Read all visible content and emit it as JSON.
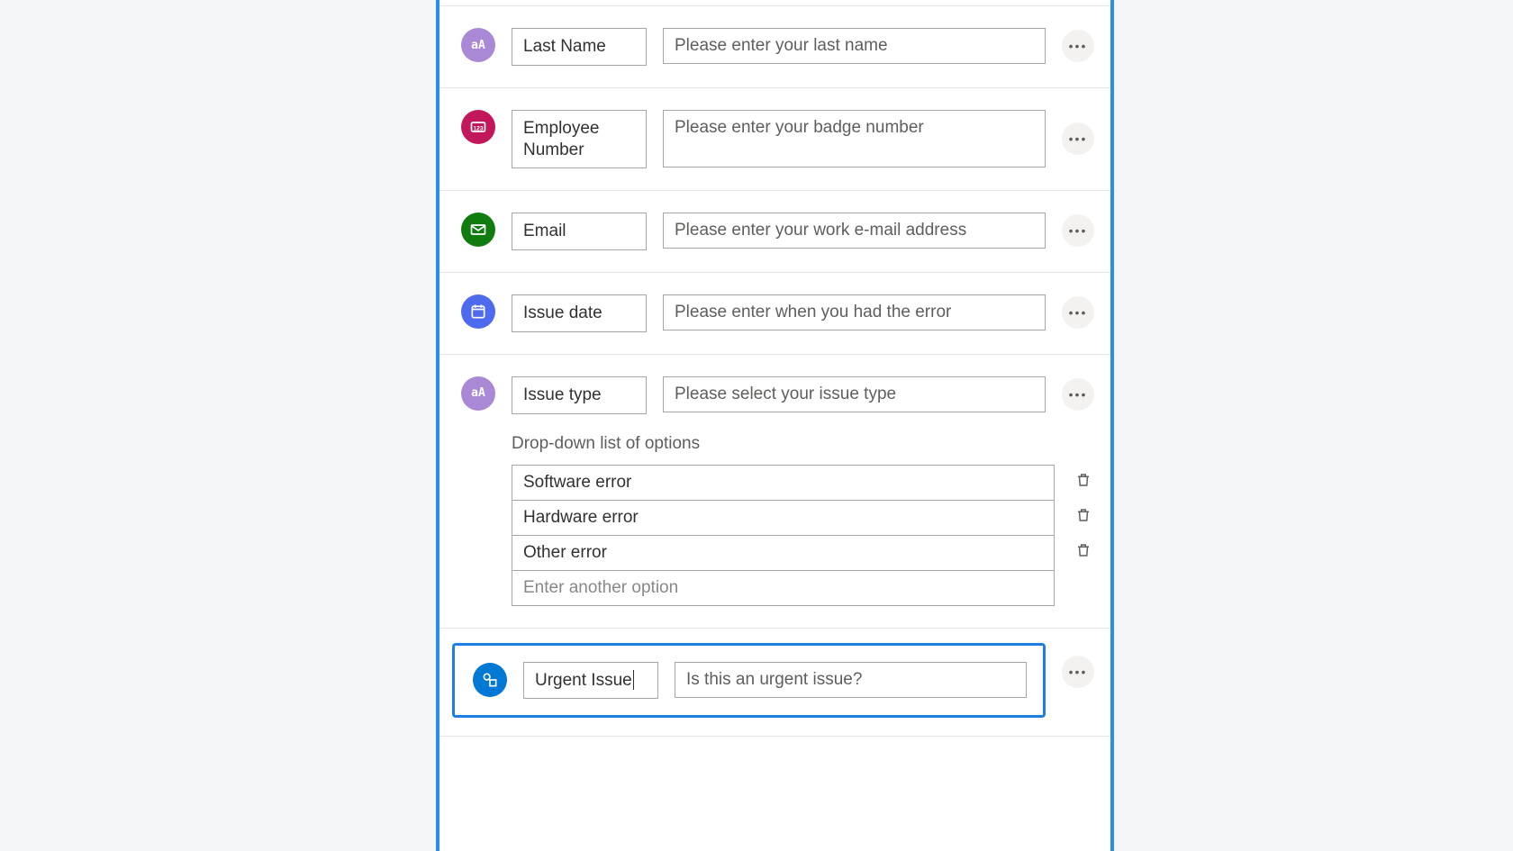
{
  "fields": [
    {
      "name": "Last Name",
      "prompt": "Please enter your last name",
      "icon": "text",
      "color": "purple"
    },
    {
      "name": "Employee Number",
      "prompt": "Please enter your badge number",
      "icon": "number",
      "color": "magenta"
    },
    {
      "name": "Email",
      "prompt": "Please enter your work e-mail address",
      "icon": "email",
      "color": "green"
    },
    {
      "name": "Issue date",
      "prompt": "Please enter when you had the error",
      "icon": "date",
      "color": "blue"
    },
    {
      "name": "Issue type",
      "prompt": "Please select your issue type",
      "icon": "text",
      "color": "purple",
      "dropdown": {
        "title": "Drop-down list of options",
        "options": [
          "Software error",
          "Hardware error",
          "Other error"
        ],
        "add_placeholder": "Enter another option"
      }
    }
  ],
  "selected_field": {
    "name": "Urgent Issue",
    "prompt": "Is this an urgent issue?",
    "icon": "multichoice",
    "color": "blue2"
  }
}
